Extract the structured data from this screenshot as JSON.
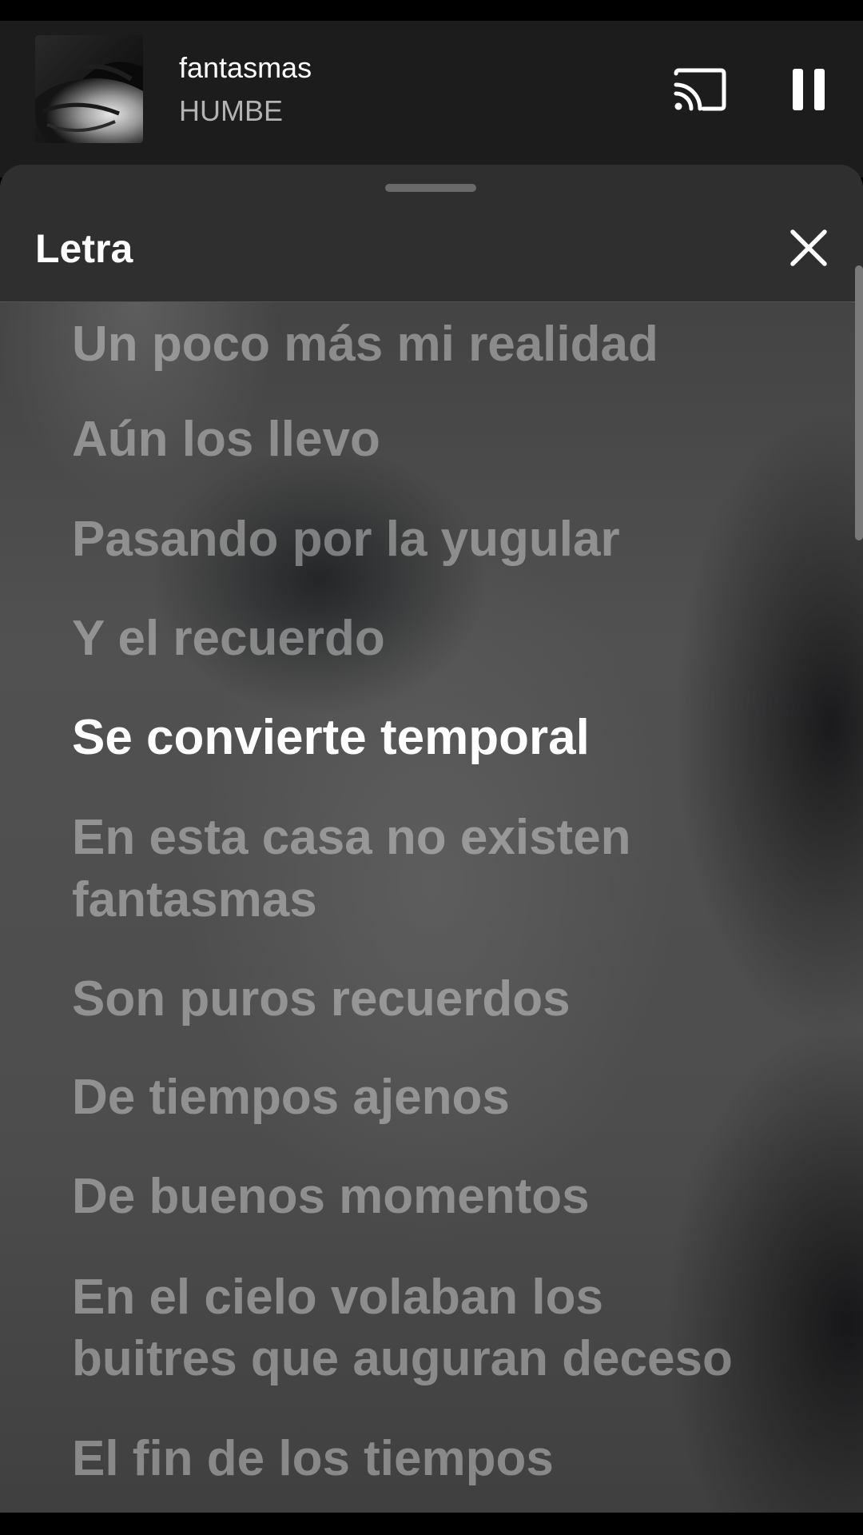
{
  "mini_player": {
    "track_title": "fantasmas",
    "artist": "HUMBE",
    "cast_icon": "cast-icon",
    "pause_icon": "pause-icon"
  },
  "lyrics_sheet": {
    "heading": "Letra",
    "close_icon": "close-icon",
    "current_line_index": 4,
    "lines": [
      "Un poco más mi realidad",
      "Aún los llevo",
      "Pasando por la yugular",
      "Y el recuerdo",
      "Se convierte temporal",
      "En esta casa no existen",
      "fantasmas",
      "Son puros recuerdos",
      "De tiempos ajenos",
      "De buenos momentos",
      "En el cielo volaban los",
      "buitres que auguran deceso",
      "El fin de los tiempos"
    ]
  },
  "colors": {
    "active_line": "#ffffff",
    "inactive_line": "rgba(255,255,255,0.38)",
    "mini_player_bg": "#1c1c1c",
    "sheet_header_bg": "#2f2f2f"
  }
}
